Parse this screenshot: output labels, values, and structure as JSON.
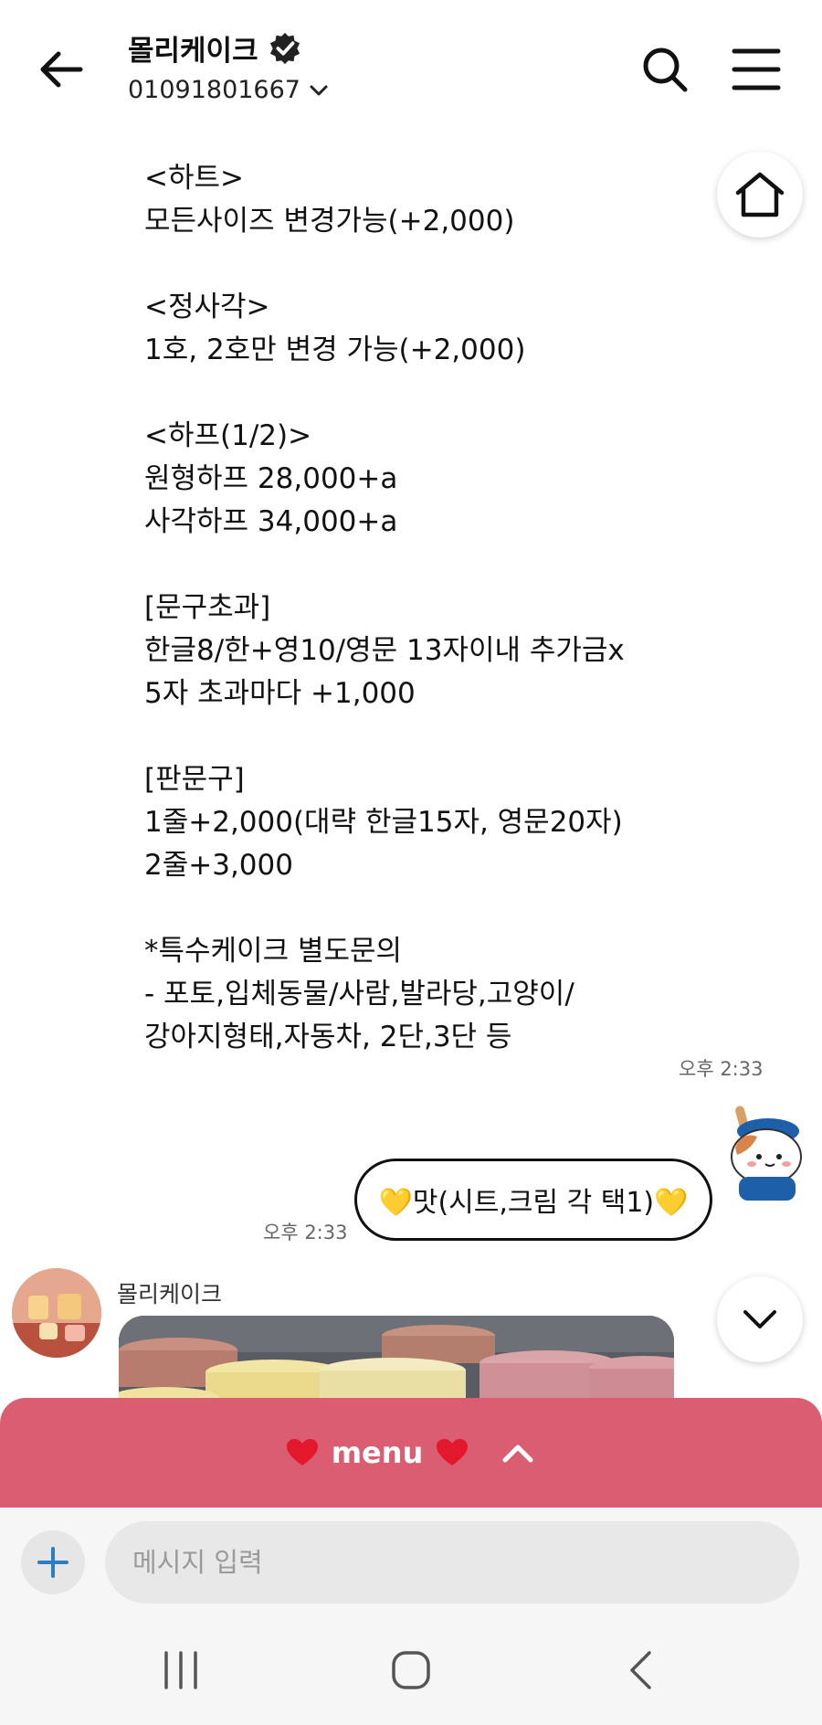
{
  "header": {
    "title": "몰리케이크",
    "phone": "01091801667"
  },
  "icons": {
    "back": "arrow-left-icon",
    "verified": "verified-badge-icon",
    "search": "search-icon",
    "menu": "hamburger-icon",
    "home": "home-icon",
    "scroll_down": "chevron-down-icon"
  },
  "notice": {
    "lines": [
      "<하트>",
      "모든사이즈 변경가능(+2,000)",
      "",
      "<정사각>",
      "1호, 2호만 변경 가능(+2,000)",
      "",
      "<하프(1/2)>",
      "원형하프 28,000+a",
      "사각하프 34,000+a",
      "",
      "[문구초과]",
      "한글8/한+영10/영문 13자이내 추가금x",
      "5자 초과마다 +1,000",
      "",
      "[판문구]",
      "1줄+2,000(대략 한글15자, 영문20자)",
      "2줄+3,000",
      "",
      "*특수케이크 별도문의",
      "- 포토,입체동물/사람,발라당,고양이/",
      "강아지형태,자동차, 2단,3단 등"
    ],
    "time": "오후 2:33"
  },
  "sent": {
    "text": "💛맛(시트,크림 각 택1)💛",
    "time": "오후 2:33"
  },
  "received": {
    "sender": "몰리케이크"
  },
  "menu_bar": {
    "label": "menu"
  },
  "input": {
    "placeholder": "메시지 입력"
  },
  "colors": {
    "menu_bar": "#db5d72",
    "plus_icon": "#2a7fc4"
  }
}
